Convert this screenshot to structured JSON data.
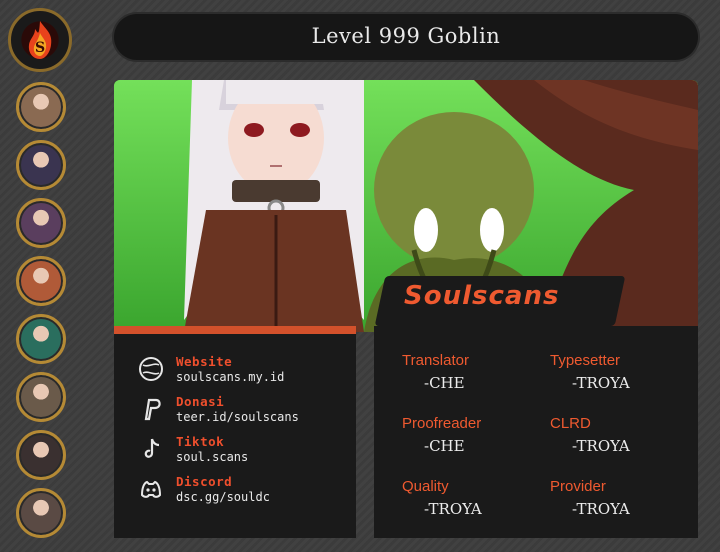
{
  "header": {
    "title": "Level 999 Goblin"
  },
  "logo": {
    "icon": "flame-logo-icon"
  },
  "avatars": [
    {
      "name": "avatar-1",
      "color": "#8a6a52"
    },
    {
      "name": "avatar-2",
      "color": "#3a3450"
    },
    {
      "name": "avatar-3",
      "color": "#5a3e5e"
    },
    {
      "name": "avatar-4",
      "color": "#b05a38"
    },
    {
      "name": "avatar-5",
      "color": "#2a6e5e"
    },
    {
      "name": "avatar-6",
      "color": "#6a5a4a"
    },
    {
      "name": "avatar-7",
      "color": "#3a3030"
    },
    {
      "name": "avatar-8",
      "color": "#5a4a44"
    }
  ],
  "links": [
    {
      "label": "Website",
      "url": "soulscans.my.id",
      "icon": "globe-icon"
    },
    {
      "label": "Donasi",
      "url": "teer.id/soulscans",
      "icon": "paypal-icon"
    },
    {
      "label": "Tiktok",
      "url": "soul.scans",
      "icon": "tiktok-icon"
    },
    {
      "label": "Discord",
      "url": "dsc.gg/souldc",
      "icon": "discord-icon"
    }
  ],
  "brand": {
    "name": "Soulscans"
  },
  "credits": [
    {
      "role": "Translator",
      "who": "-CHE"
    },
    {
      "role": "Typesetter",
      "who": "-TROYA"
    },
    {
      "role": "Proofreader",
      "who": "-CHE"
    },
    {
      "role": "CLRD",
      "who": "-TROYA"
    },
    {
      "role": "Quality",
      "who": "-TROYA"
    },
    {
      "role": "Provider",
      "who": "-TROYA"
    }
  ],
  "colors": {
    "accent": "#ef5a30",
    "panel": "#1a1a1a",
    "gold": "#b58a35",
    "art_bg": "#5fd14a"
  }
}
